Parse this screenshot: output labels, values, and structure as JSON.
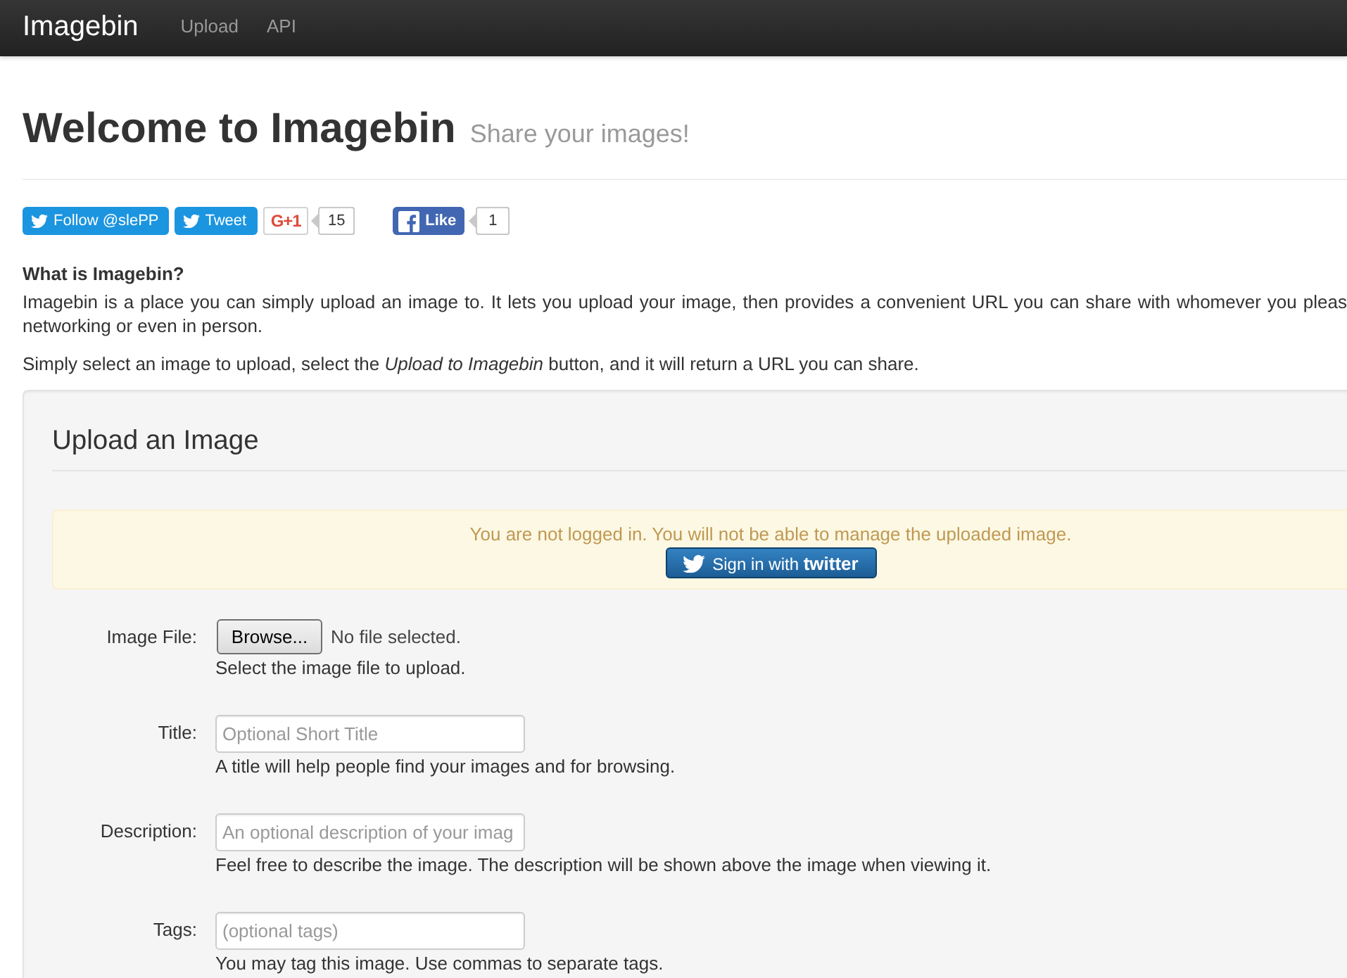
{
  "navbar": {
    "brand": "Imagebin",
    "links": [
      "Upload",
      "API"
    ]
  },
  "header": {
    "title": "Welcome to Imagebin",
    "subtitle": "Share your images!"
  },
  "social": [
    {
      "kind": "twitter-follow",
      "label": "Follow @slePP"
    },
    {
      "kind": "twitter-tweet",
      "label": "Tweet"
    },
    {
      "kind": "plus-one",
      "label": "G+1",
      "count": "15"
    },
    {
      "kind": "like",
      "label": "Like",
      "count": "1"
    }
  ],
  "about": {
    "heading": "What is Imagebin?",
    "lines": [
      "Imagebin is a place you can simply upload an image to. It lets you upload your image, then provides a convenient URL you can share with whomever you pleas",
      "networking or even in person."
    ],
    "instructions": "Simply select an image to upload, select the *Upload to Imagebin* button, and it will return a URL you can share."
  },
  "upload": {
    "title": "Upload an Image",
    "alert": {
      "message": "You are not logged in. You will not be able to manage the uploaded image.",
      "button": "Sign in with **twitter**"
    },
    "fields": [
      {
        "kind": "file",
        "label": "Image File:",
        "button": "Browse...",
        "status": "No file selected.",
        "help": "Select the image file to upload."
      },
      {
        "kind": "text",
        "label": "Title:",
        "placeholder": "Optional Short Title",
        "help": "A title will help people find your images and for browsing."
      },
      {
        "kind": "text",
        "label": "Description:",
        "placeholder": "An optional description of your imag",
        "help": "Feel free to describe the image. The description will be shown above the image when viewing it."
      },
      {
        "kind": "text",
        "label": "Tags:",
        "placeholder": "(optional tags)",
        "help": "You may tag this image. Use commas to separate tags."
      }
    ]
  }
}
